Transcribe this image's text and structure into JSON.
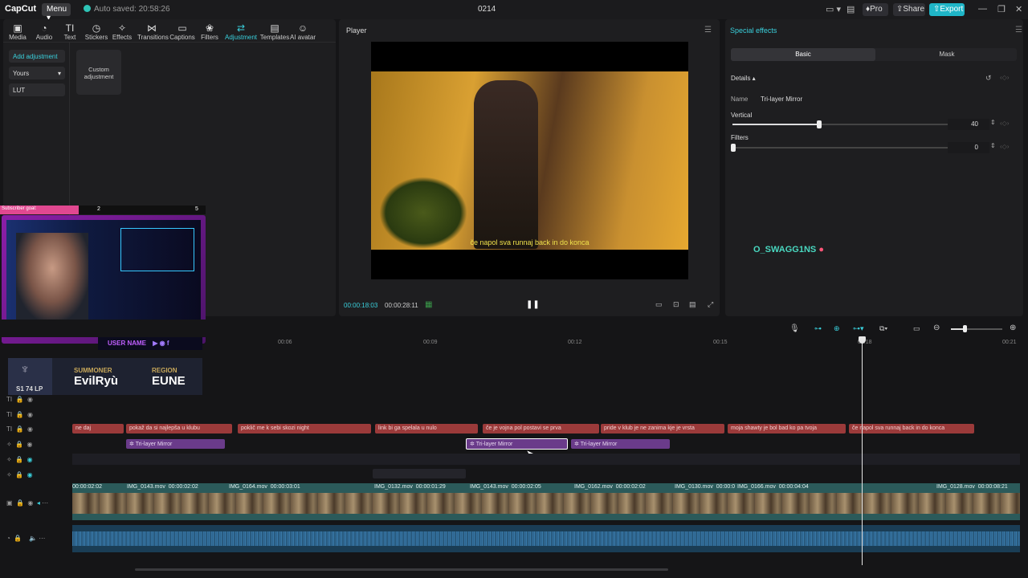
{
  "app": {
    "logo": "CapCut",
    "menu": "Menu",
    "autosave": "Auto saved: 20:58:26",
    "doc_title": "0214",
    "pro": "Pro",
    "share": "Share",
    "export": "Export"
  },
  "toolbar": [
    {
      "label": "Media",
      "icon": "media-icon"
    },
    {
      "label": "Audio",
      "icon": "audio-icon"
    },
    {
      "label": "Text",
      "icon": "text-icon"
    },
    {
      "label": "Stickers",
      "icon": "sticker-icon"
    },
    {
      "label": "Effects",
      "icon": "effects-icon"
    },
    {
      "label": "Transitions",
      "icon": "transitions-icon"
    },
    {
      "label": "Captions",
      "icon": "captions-icon"
    },
    {
      "label": "Filters",
      "icon": "filters-icon"
    },
    {
      "label": "Adjustment",
      "icon": "adjustment-icon",
      "active": true
    },
    {
      "label": "Templates",
      "icon": "templates-icon"
    },
    {
      "label": "AI avatar",
      "icon": "ai-avatar-icon"
    }
  ],
  "left_panel": {
    "add_adjustment": "Add adjustment",
    "yours": "Yours",
    "lut": "LUT",
    "custom_adjustment": "Custom adjustment"
  },
  "overlay": {
    "goal_label": "Subscriber goal:",
    "goal_current": "2",
    "goal_target": "5",
    "username": "USER NAME",
    "summoner_label": "SUMMONER",
    "summoner_name": "EvilRyù",
    "region_label": "REGION",
    "region_value": "EUNE",
    "lp": "74 LP",
    "rank_prefix": "S1"
  },
  "player": {
    "title": "Player",
    "subtitle": "če napol sva runnaj back in do konca",
    "current_time": "00:00:18:03",
    "total_time": "00:00:28:11"
  },
  "effects": {
    "title": "Special effects",
    "tabs": [
      "Basic",
      "Mask"
    ],
    "details_label": "Details",
    "name_label": "Name",
    "name_value": "Tri-layer Mirror",
    "vertical_label": "Vertical",
    "vertical_value": "40",
    "vertical_fraction": 0.4,
    "filters_label": "Filters",
    "filters_value": "0",
    "watermark": "O_SWAGG1NS"
  },
  "ruler_ticks": [
    "00:06",
    "00:09",
    "00:12",
    "00:15",
    "00:18",
    "00:21"
  ],
  "text_clips": [
    "ne daj",
    "pokaž da si najlepša u klubu",
    "poklič me k sebi skozi night",
    "link bi ga spelala u nulo",
    "če je vojna pol postavi se prva",
    "pride v klub je ne zanima kje je vrsta",
    "moja shawty je bol bad ko pa tvoja",
    "če napol sva runnaj back in do konca"
  ],
  "effect_clips": [
    "Tri-layer Mirror",
    "Tri-layer Mirror",
    "Tri-layer Mirror"
  ],
  "video_clips": [
    {
      "name": "",
      "duration": "00:00:02:02"
    },
    {
      "name": "IMG_0143.mov",
      "duration": "00:00:02:02"
    },
    {
      "name": "IMG_0164.mov",
      "duration": "00:00:03:01"
    },
    {
      "name": "IMG_0132.mov",
      "duration": "00:00:01:29"
    },
    {
      "name": "IMG_0143.mov",
      "duration": "00:00:02:05"
    },
    {
      "name": "IMG_0162.mov",
      "duration": "00:00:02:02"
    },
    {
      "name": "IMG_0130.mov",
      "duration": "00:00:0"
    },
    {
      "name": "IMG_0166.mov",
      "duration": "00:00:04:04"
    },
    {
      "name": "IMG_0128.mov",
      "duration": "00:00:08:21"
    }
  ]
}
